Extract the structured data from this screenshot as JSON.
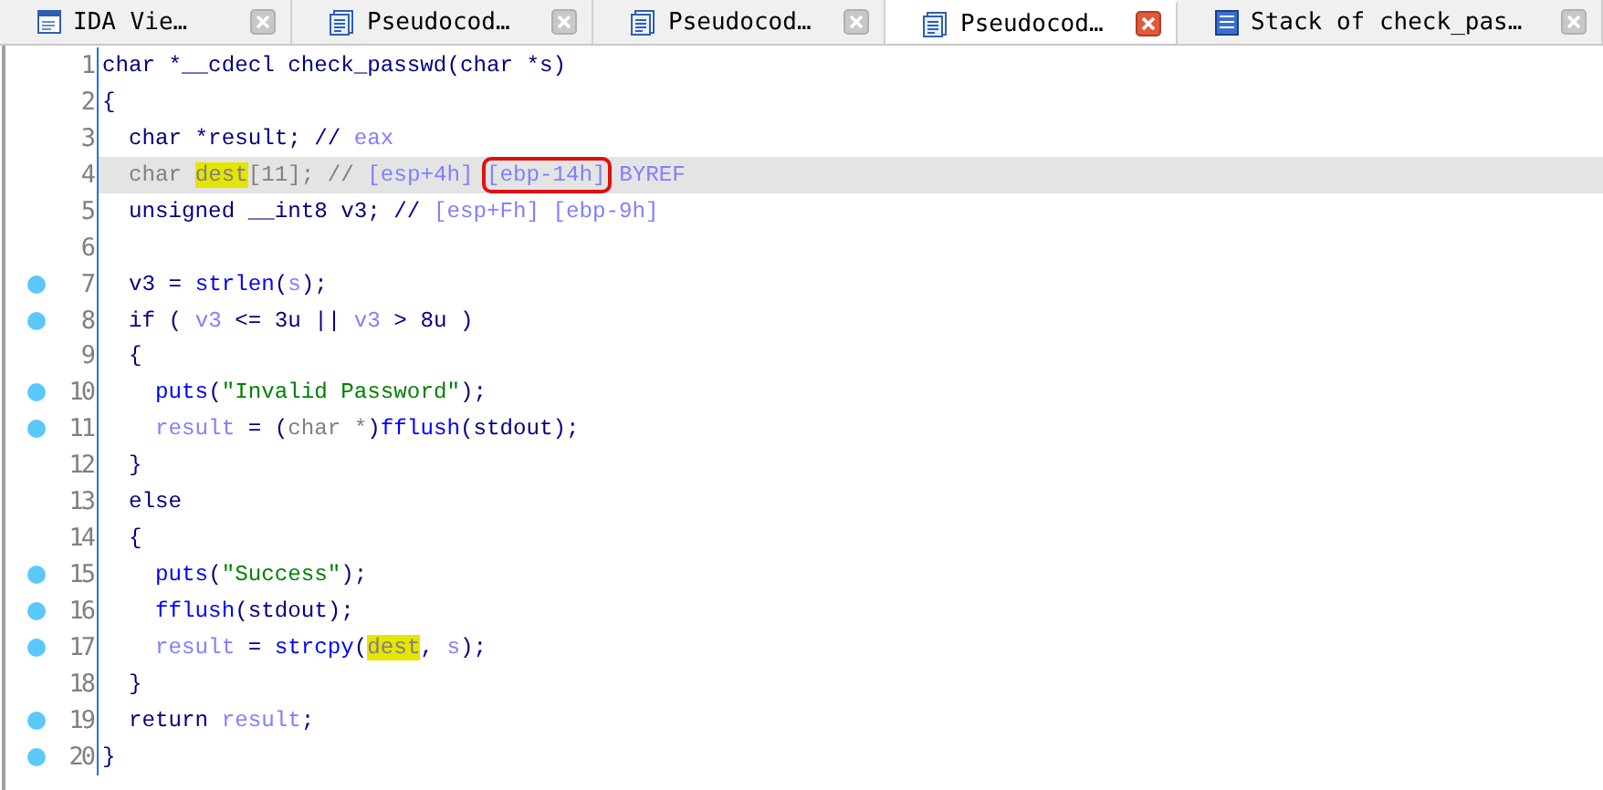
{
  "tabs": [
    {
      "label": "IDA Vie…",
      "kind": "ida",
      "selected": false
    },
    {
      "label": "Pseudocod…",
      "kind": "pseudocode",
      "selected": false
    },
    {
      "label": "Pseudocod…",
      "kind": "pseudocode",
      "selected": false
    },
    {
      "label": "Pseudocod…",
      "kind": "pseudocode",
      "selected": true
    },
    {
      "label": "Stack of check_pas…",
      "kind": "stack",
      "selected": false
    }
  ],
  "lines": [
    {
      "number": "1",
      "breakpoint": false,
      "current": false,
      "tokens": [
        {
          "text": "char *__cdecl check_passwd(char *s)",
          "kind": "text"
        }
      ]
    },
    {
      "number": "2",
      "breakpoint": false,
      "current": false,
      "tokens": [
        {
          "text": "{",
          "kind": "text"
        }
      ]
    },
    {
      "number": "3",
      "breakpoint": false,
      "current": false,
      "tokens": [
        {
          "text": "  char *result; // ",
          "kind": "text"
        },
        {
          "text": "eax",
          "kind": "local"
        }
      ]
    },
    {
      "number": "4",
      "breakpoint": false,
      "current": true,
      "tokens": [
        {
          "text": "  char ",
          "kind": "dim"
        },
        {
          "text": "dest",
          "kind": "marked"
        },
        {
          "text": "[11]; // ",
          "kind": "dim"
        },
        {
          "text": "[esp+4h] ",
          "kind": "local"
        },
        {
          "text": "[ebp-14h]",
          "kind": "boxed"
        },
        {
          "text": " BYREF",
          "kind": "local"
        }
      ]
    },
    {
      "number": "5",
      "breakpoint": false,
      "current": false,
      "tokens": [
        {
          "text": "  unsigned __int8 v3; // ",
          "kind": "text"
        },
        {
          "text": "[esp+Fh] [ebp-9h]",
          "kind": "local"
        }
      ]
    },
    {
      "number": "6",
      "breakpoint": false,
      "current": false
    },
    {
      "number": "7",
      "breakpoint": true,
      "current": false,
      "tokens": [
        {
          "text": "  v3 = ",
          "kind": "text"
        },
        {
          "text": "strlen",
          "kind": "func"
        },
        {
          "text": "(",
          "kind": "text"
        },
        {
          "text": "s",
          "kind": "local"
        },
        {
          "text": ");",
          "kind": "text"
        }
      ]
    },
    {
      "number": "8",
      "breakpoint": true,
      "current": false,
      "tokens": [
        {
          "text": "  if ( ",
          "kind": "text"
        },
        {
          "text": "v3",
          "kind": "local"
        },
        {
          "text": " <= 3u || ",
          "kind": "text"
        },
        {
          "text": "v3",
          "kind": "local"
        },
        {
          "text": " > 8u )",
          "kind": "text"
        }
      ]
    },
    {
      "number": "9",
      "breakpoint": false,
      "current": false,
      "tokens": [
        {
          "text": "  {",
          "kind": "text"
        }
      ]
    },
    {
      "number": "10",
      "breakpoint": true,
      "current": false,
      "tokens": [
        {
          "text": "    puts",
          "kind": "func"
        },
        {
          "text": "(",
          "kind": "text"
        },
        {
          "text": "\"Invalid Password\"",
          "kind": "string"
        },
        {
          "text": ");",
          "kind": "text"
        }
      ]
    },
    {
      "number": "11",
      "breakpoint": true,
      "current": false,
      "tokens": [
        {
          "text": "    result",
          "kind": "local"
        },
        {
          "text": " = (",
          "kind": "text"
        },
        {
          "text": "char *",
          "kind": "dim"
        },
        {
          "text": ")",
          "kind": "text"
        },
        {
          "text": "fflush",
          "kind": "func"
        },
        {
          "text": "(stdout);",
          "kind": "text"
        }
      ]
    },
    {
      "number": "12",
      "breakpoint": false,
      "current": false,
      "tokens": [
        {
          "text": "  }",
          "kind": "text"
        }
      ]
    },
    {
      "number": "13",
      "breakpoint": false,
      "current": false,
      "tokens": [
        {
          "text": "  else",
          "kind": "text"
        }
      ]
    },
    {
      "number": "14",
      "breakpoint": false,
      "current": false,
      "tokens": [
        {
          "text": "  {",
          "kind": "text"
        }
      ]
    },
    {
      "number": "15",
      "breakpoint": true,
      "current": false,
      "tokens": [
        {
          "text": "    puts",
          "kind": "func"
        },
        {
          "text": "(",
          "kind": "text"
        },
        {
          "text": "\"Success\"",
          "kind": "string"
        },
        {
          "text": ");",
          "kind": "text"
        }
      ]
    },
    {
      "number": "16",
      "breakpoint": true,
      "current": false,
      "tokens": [
        {
          "text": "    fflush",
          "kind": "func"
        },
        {
          "text": "(stdout);",
          "kind": "text"
        }
      ]
    },
    {
      "number": "17",
      "breakpoint": true,
      "current": false,
      "tokens": [
        {
          "text": "    result",
          "kind": "local"
        },
        {
          "text": " = ",
          "kind": "text"
        },
        {
          "text": "strcpy",
          "kind": "func"
        },
        {
          "text": "(",
          "kind": "text"
        },
        {
          "text": "dest",
          "kind": "marked"
        },
        {
          "text": ", ",
          "kind": "text"
        },
        {
          "text": "s",
          "kind": "local"
        },
        {
          "text": ");",
          "kind": "text"
        }
      ]
    },
    {
      "number": "18",
      "breakpoint": false,
      "current": false,
      "tokens": [
        {
          "text": "  }",
          "kind": "text"
        }
      ]
    },
    {
      "number": "19",
      "breakpoint": true,
      "current": false,
      "tokens": [
        {
          "text": "  return ",
          "kind": "text"
        },
        {
          "text": "result",
          "kind": "local"
        },
        {
          "text": ";",
          "kind": "text"
        }
      ]
    },
    {
      "number": "20",
      "breakpoint": true,
      "current": false,
      "tokens": [
        {
          "text": "}",
          "kind": "text"
        }
      ]
    }
  ]
}
